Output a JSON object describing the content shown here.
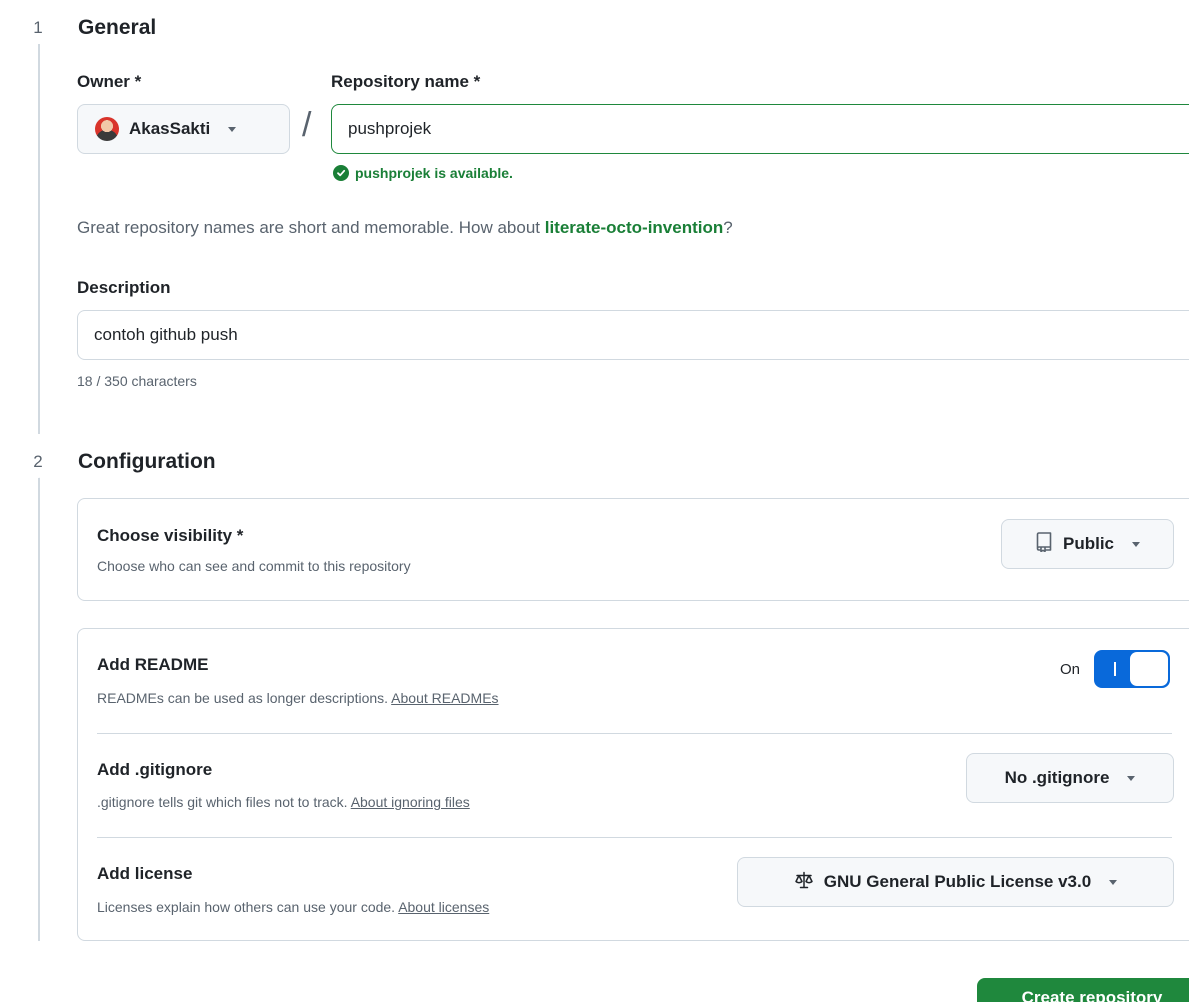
{
  "steps": [
    {
      "number": "1",
      "title": "General"
    },
    {
      "number": "2",
      "title": "Configuration"
    }
  ],
  "general": {
    "owner_label": "Owner *",
    "owner_value": "AkasSakti",
    "repo_label": "Repository name *",
    "repo_value": "pushprojek",
    "availability": "pushprojek is available.",
    "hint_prefix": "Great repository names are short and memorable. How about ",
    "hint_suggestion": "literate-octo-invention",
    "hint_suffix": "?",
    "description_label": "Description",
    "description_value": "contoh github push",
    "char_count": "18 / 350 characters"
  },
  "configuration": {
    "visibility": {
      "title": "Choose visibility *",
      "subtitle": "Choose who can see and commit to this repository",
      "selected": "Public",
      "icon": "repo-icon"
    },
    "readme": {
      "title": "Add README",
      "subtitle": "READMEs can be used as longer descriptions. ",
      "link": "About READMEs",
      "toggle_label": "On",
      "toggle_on": true
    },
    "gitignore": {
      "title": "Add .gitignore",
      "subtitle": ".gitignore tells git which files not to track. ",
      "link": "About ignoring files",
      "selected": "No .gitignore"
    },
    "license": {
      "title": "Add license",
      "subtitle": "Licenses explain how others can use your code. ",
      "link": "About licenses",
      "selected": "GNU General Public License v3.0",
      "icon": "law-icon"
    }
  },
  "create_button": "Create repository",
  "colors": {
    "success": "#1a7f37",
    "primary_button": "#1f883d",
    "toggle": "#0969da",
    "muted": "#59636e",
    "border": "#d1d9e0"
  }
}
